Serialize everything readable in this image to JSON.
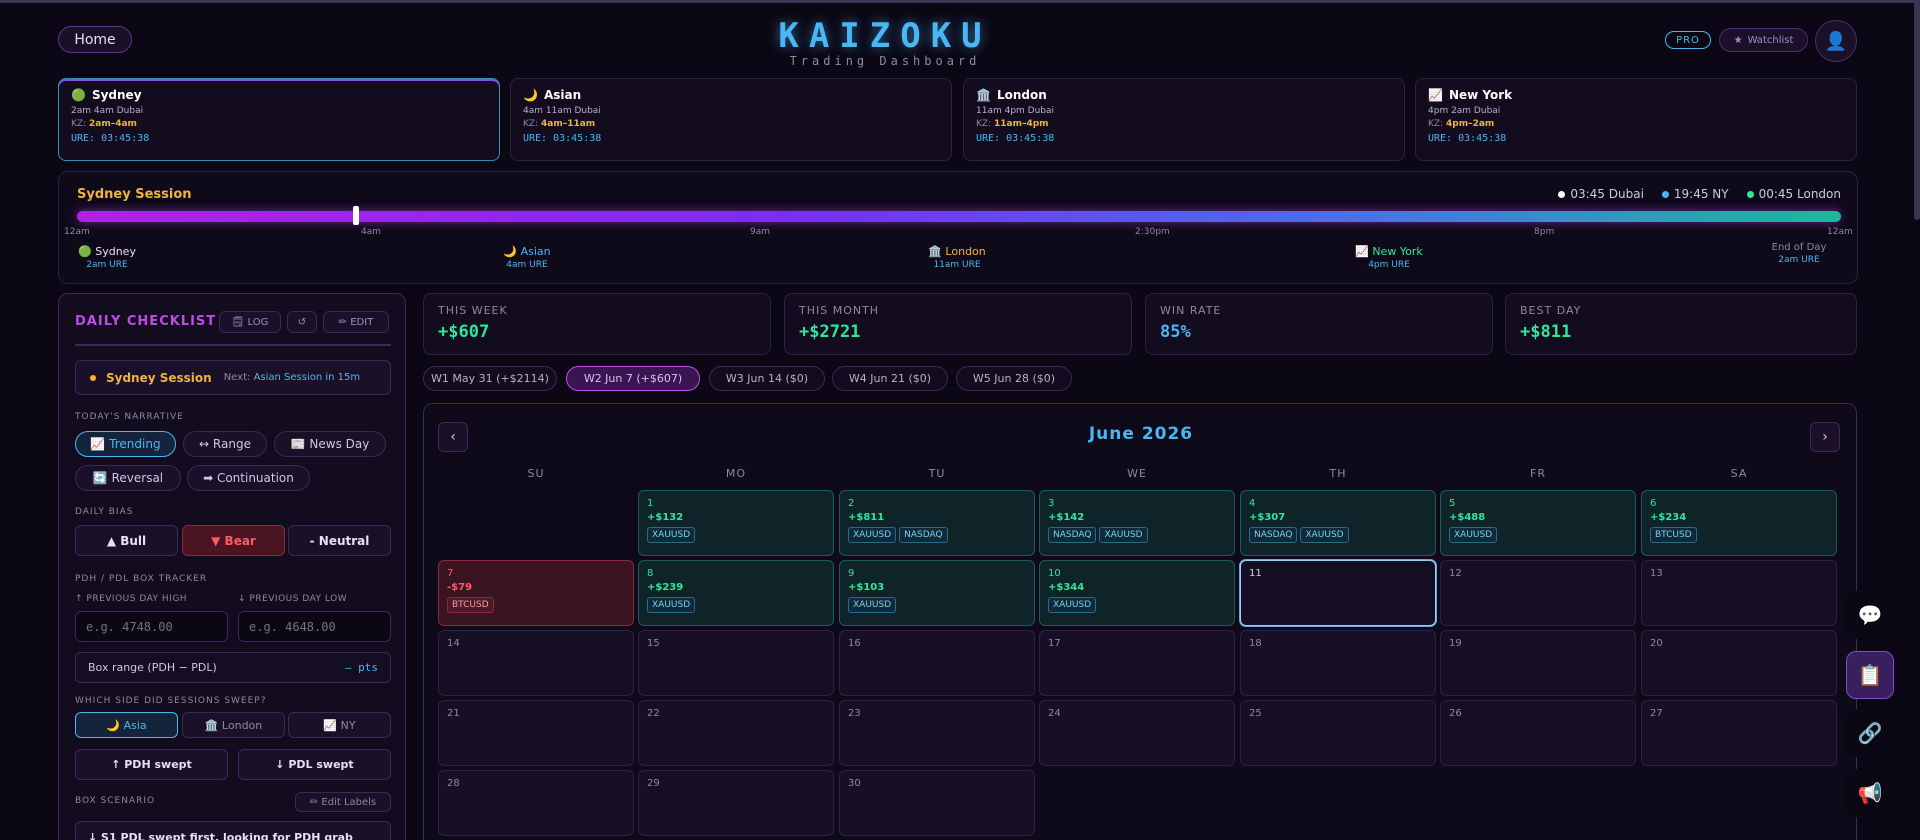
{
  "header": {
    "home_label": "Home",
    "logo": "KAIZOKU",
    "subtitle": "Trading Dashboard",
    "pro_badge": "PRO",
    "watchlist_label": "Watchlist",
    "watchlist_icon": "★",
    "avatar_icon": "👤"
  },
  "sessions": [
    {
      "icon": "🟢",
      "name": "Sydney",
      "hours": "2am 4am Dubai",
      "kz_label": "KZ:",
      "kz": "2am–4am",
      "ure": "URE: 03:45:38"
    },
    {
      "icon": "🌙",
      "name": "Asian",
      "hours": "4am 11am Dubai",
      "kz_label": "KZ:",
      "kz": "4am–11am",
      "ure": "URE: 03:45:38"
    },
    {
      "icon": "🏛️",
      "name": "London",
      "hours": "11am 4pm Dubai",
      "kz_label": "KZ:",
      "kz": "11am–4pm",
      "ure": "URE: 03:45:38"
    },
    {
      "icon": "📈",
      "name": "New York",
      "hours": "4pm 2am Dubai",
      "kz_label": "KZ:",
      "kz": "4pm–2am",
      "ure": "URE: 03:45:38"
    }
  ],
  "timeline": {
    "title": "Sydney Session",
    "progress": 0.158,
    "clocks": [
      {
        "dot_color": "#ffffff",
        "text": "03:45 Dubai"
      },
      {
        "dot_color": "#49b6f5",
        "text": "19:45 NY"
      },
      {
        "dot_color": "#2ee89a",
        "text": "00:45 London"
      }
    ],
    "ticks": [
      "12am",
      "4am",
      "9am",
      "2:30pm",
      "8pm",
      "12am"
    ],
    "markers": [
      {
        "name": "🟢 Sydney",
        "time": "2am URE",
        "color": "#e8dff8"
      },
      {
        "name": "🌙 Asian",
        "time": "4am URE",
        "color": "#49b6f5"
      },
      {
        "name": "🏛️ London",
        "time": "11am URE",
        "color": "#f0b43c"
      },
      {
        "name": "📈 New York",
        "time": "4pm URE",
        "color": "#2ee89a"
      },
      {
        "name": "End of Day",
        "time": "2am URE",
        "color": "#8a8aa0"
      }
    ]
  },
  "checklist": {
    "title": "DAILY CHECKLIST",
    "log_label": "🗒 LOG",
    "reset_label": "↺",
    "edit_label": "✏ EDIT",
    "session_name": "Sydney Session",
    "next_prefix": "Next:",
    "next_value": "Asian Session in 15m",
    "narrative_label": "TODAY'S NARRATIVE",
    "narratives": [
      "📈 Trending",
      "↔ Range",
      "📰 News Day",
      "🔄 Reversal",
      "➡ Continuation"
    ],
    "bias_label": "DAILY BIAS",
    "bias": [
      "▲ Bull",
      "▼ Bear",
      "- Neutral"
    ],
    "pdh_tracker_label": "PDH / PDL BOX TRACKER",
    "pdh_label": "↑ PREVIOUS DAY HIGH",
    "pdl_label": "↓ PREVIOUS DAY LOW",
    "pdh_placeholder": "e.g. 4748.00",
    "pdl_placeholder": "e.g. 4648.00",
    "range_label": "Box range (PDH − PDL)",
    "range_value": "– pts",
    "sweep_label": "WHICH SIDE DID SESSIONS SWEEP?",
    "sweep_options": [
      "🌙 Asia",
      "🏛️ London",
      "📈 NY"
    ],
    "pdh_swept": "↑ PDH swept",
    "pdl_swept": "↓ PDL swept",
    "scenario_label": "BOX SCENARIO",
    "edit_labels": "✏ Edit Labels",
    "scenario_text": "↓ S1 PDL swept first, looking for PDH grab"
  },
  "stats": [
    {
      "label": "THIS WEEK",
      "value": "+$607"
    },
    {
      "label": "THIS MONTH",
      "value": "+$2721"
    },
    {
      "label": "WIN RATE",
      "value": "85%"
    },
    {
      "label": "BEST DAY",
      "value": "+$811"
    }
  ],
  "weeks": [
    "W1 May 31 (+$2114)",
    "W2 Jun 7 (+$607)",
    "W3 Jun 14 ($0)",
    "W4 Jun 21 ($0)",
    "W5 Jun 28 ($0)"
  ],
  "calendar": {
    "title": "June 2026",
    "prev": "‹",
    "next": "›",
    "dow": [
      "SU",
      "MO",
      "TU",
      "WE",
      "TH",
      "FR",
      "SA"
    ],
    "days": [
      {
        "n": "1",
        "pnl": "+$132",
        "tags": [
          "XAUUSD"
        ],
        "status": "win"
      },
      {
        "n": "2",
        "pnl": "+$811",
        "tags": [
          "XAUUSD",
          "NASDAQ"
        ],
        "status": "win"
      },
      {
        "n": "3",
        "pnl": "+$142",
        "tags": [
          "NASDAQ",
          "XAUUSD"
        ],
        "status": "win"
      },
      {
        "n": "4",
        "pnl": "+$307",
        "tags": [
          "NASDAQ",
          "XAUUSD"
        ],
        "status": "win"
      },
      {
        "n": "5",
        "pnl": "+$488",
        "tags": [
          "XAUUSD"
        ],
        "status": "win"
      },
      {
        "n": "6",
        "pnl": "+$234",
        "tags": [
          "BTCUSD"
        ],
        "status": "win"
      },
      {
        "n": "7",
        "pnl": "-$79",
        "tags": [
          "BTCUSD"
        ],
        "status": "loss"
      },
      {
        "n": "8",
        "pnl": "+$239",
        "tags": [
          "XAUUSD"
        ],
        "status": "win"
      },
      {
        "n": "9",
        "pnl": "+$103",
        "tags": [
          "XAUUSD"
        ],
        "status": "win"
      },
      {
        "n": "10",
        "pnl": "+$344",
        "tags": [
          "XAUUSD"
        ],
        "status": "win"
      },
      {
        "n": "11",
        "pnl": "",
        "tags": [],
        "status": "today"
      },
      {
        "n": "12",
        "pnl": "",
        "tags": [],
        "status": ""
      },
      {
        "n": "13",
        "pnl": "",
        "tags": [],
        "status": ""
      },
      {
        "n": "14",
        "pnl": "",
        "tags": [],
        "status": ""
      },
      {
        "n": "15",
        "pnl": "",
        "tags": [],
        "status": ""
      },
      {
        "n": "16",
        "pnl": "",
        "tags": [],
        "status": ""
      },
      {
        "n": "17",
        "pnl": "",
        "tags": [],
        "status": ""
      },
      {
        "n": "18",
        "pnl": "",
        "tags": [],
        "status": ""
      },
      {
        "n": "19",
        "pnl": "",
        "tags": [],
        "status": ""
      },
      {
        "n": "20",
        "pnl": "",
        "tags": [],
        "status": ""
      },
      {
        "n": "21",
        "pnl": "",
        "tags": [],
        "status": ""
      },
      {
        "n": "22",
        "pnl": "",
        "tags": [],
        "status": ""
      },
      {
        "n": "23",
        "pnl": "",
        "tags": [],
        "status": ""
      },
      {
        "n": "24",
        "pnl": "",
        "tags": [],
        "status": ""
      },
      {
        "n": "25",
        "pnl": "",
        "tags": [],
        "status": ""
      },
      {
        "n": "26",
        "pnl": "",
        "tags": [],
        "status": ""
      },
      {
        "n": "27",
        "pnl": "",
        "tags": [],
        "status": ""
      },
      {
        "n": "28",
        "pnl": "",
        "tags": [],
        "status": ""
      },
      {
        "n": "29",
        "pnl": "",
        "tags": [],
        "status": ""
      },
      {
        "n": "30",
        "pnl": "",
        "tags": [],
        "status": ""
      }
    ]
  },
  "rail": [
    {
      "icon": "💬",
      "name": "chat-icon"
    },
    {
      "icon": "📋",
      "name": "clipboard-icon"
    },
    {
      "icon": "🔗",
      "name": "link-icon"
    },
    {
      "icon": "📢",
      "name": "megaphone-icon"
    }
  ],
  "colors": {
    "accent": "#49b6f5",
    "gold": "#f0b43c",
    "win": "#2ee89a",
    "loss": "#ff5a6a",
    "purple": "#c04ae8"
  }
}
